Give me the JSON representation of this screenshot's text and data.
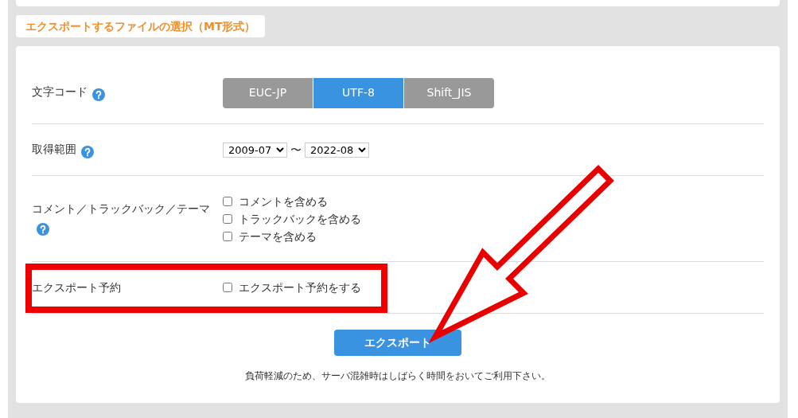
{
  "section_title": "エクスポートするファイルの選択（MT形式）",
  "fields": [
    {
      "kind": "segmented",
      "label": "文字コード",
      "help": true,
      "options": [
        {
          "label": "EUC-JP",
          "selected": false
        },
        {
          "label": "UTF-8",
          "selected": true
        },
        {
          "label": "Shift_JIS",
          "selected": false
        }
      ]
    },
    {
      "kind": "range",
      "label": "取得範囲",
      "help": true,
      "from": "2009-07",
      "separator": "〜",
      "to": "2022-08"
    },
    {
      "kind": "checkboxes",
      "label": "コメント／トラックバック／テーマ",
      "help": true,
      "options": [
        {
          "label": "コメントを含める",
          "checked": false
        },
        {
          "label": "トラックバックを含める",
          "checked": false
        },
        {
          "label": "テーマを含める",
          "checked": false
        }
      ]
    },
    {
      "kind": "checkboxes",
      "label": "エクスポート予約",
      "help": false,
      "highlighted": true,
      "options": [
        {
          "label": "エクスポート予約をする",
          "checked": false
        }
      ]
    }
  ],
  "export_button": "エクスポート",
  "note": "負荷軽減のため、サーバ混雑時はしばらく時間をおいてご利用下さい。"
}
